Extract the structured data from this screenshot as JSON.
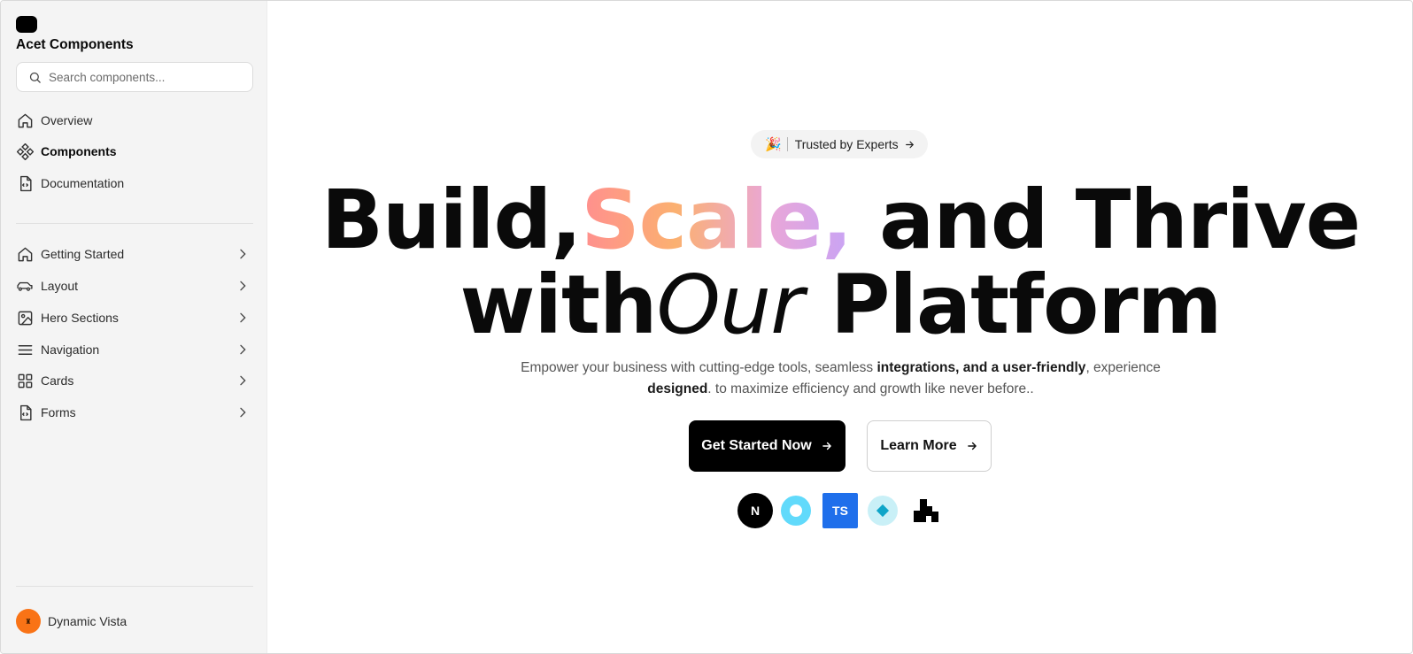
{
  "sidebar": {
    "brand": "Acet Components",
    "search_placeholder": "Search components...",
    "primary_items": [
      {
        "label": "Overview",
        "icon": "home-icon"
      },
      {
        "label": "Components",
        "icon": "components-icon"
      },
      {
        "label": "Documentation",
        "icon": "file-code-icon"
      }
    ],
    "section_items": [
      {
        "label": "Getting Started",
        "icon": "home-icon"
      },
      {
        "label": "Layout",
        "icon": "car-icon"
      },
      {
        "label": "Hero Sections",
        "icon": "image-icon"
      },
      {
        "label": "Navigation",
        "icon": "menu-icon"
      },
      {
        "label": "Cards",
        "icon": "grid-icon"
      },
      {
        "label": "Forms",
        "icon": "file-code-icon"
      }
    ],
    "user": {
      "name": "Dynamic Vista"
    }
  },
  "hero": {
    "badge": {
      "emoji": "🎉",
      "text": "Trusted by Experts"
    },
    "headline_line1": {
      "part1": "Build,",
      "highlight": "Scale,",
      "part2": " and Thrive"
    },
    "headline_line2": {
      "part1": "with",
      "italic": "Our",
      "part2": " Platform"
    },
    "subtitle": {
      "s1": "Empower your business with cutting-edge tools, seamless ",
      "b1": "integrations, and a user-friendly",
      "s2": ", experience ",
      "b2": "designed",
      "s3": ". to maximize efficiency and growth like never before.."
    },
    "primary_button": "Get Started Now",
    "secondary_button": "Learn More",
    "tech_logos": {
      "nextjs": "N",
      "typescript": "TS"
    }
  },
  "colors": {
    "avatar": "#f97316",
    "primary_button": "#000000",
    "typescript": "#1f6feb",
    "react": "#61dafb",
    "gradient": [
      "#ff8f8f",
      "#fbb070",
      "#e9a7d8",
      "#c8a3f5"
    ]
  }
}
